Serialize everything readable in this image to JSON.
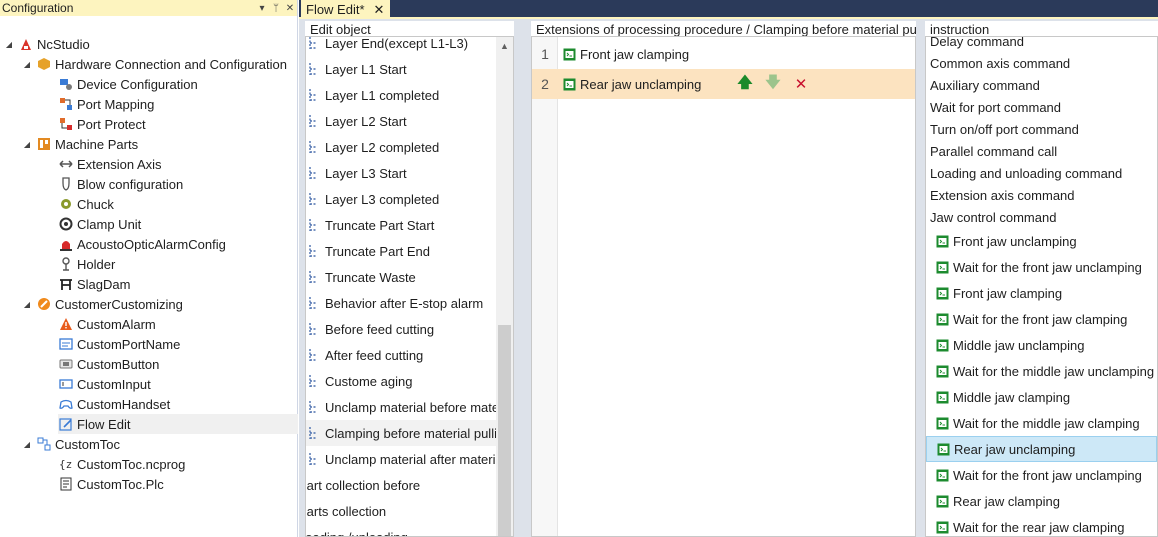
{
  "config_panel": {
    "title": "Configuration",
    "pin_glyph": "▾",
    "pin2_glyph": "ᛘ",
    "close_glyph": "✕",
    "tree": [
      {
        "label": "NcStudio",
        "level": 0,
        "expander": "◢",
        "icon": "app-icon",
        "color": "#d9342b"
      },
      {
        "label": "Hardware Connection and Configuration",
        "level": 1,
        "expander": "◢",
        "icon": "hex-icon",
        "color": "#e6a22a"
      },
      {
        "label": "Device Configuration",
        "level": 2,
        "icon": "device-config-icon",
        "color": "#3a7bd5"
      },
      {
        "label": "Port Mapping",
        "level": 2,
        "icon": "port-mapping-icon",
        "color": "#e06c2b"
      },
      {
        "label": "Port Protect",
        "level": 2,
        "icon": "port-protect-icon",
        "color": "#e06c2b"
      },
      {
        "label": "Machine Parts",
        "level": 1,
        "expander": "◢",
        "icon": "machine-parts-icon",
        "color": "#e38a22"
      },
      {
        "label": "Extension Axis",
        "level": 2,
        "icon": "extension-axis-icon",
        "color": "#555555"
      },
      {
        "label": "Blow configuration",
        "level": 2,
        "icon": "blow-icon",
        "color": "#555555"
      },
      {
        "label": "Chuck",
        "level": 2,
        "icon": "chuck-icon",
        "color": "#8a9a2c"
      },
      {
        "label": "Clamp Unit",
        "level": 2,
        "icon": "clamp-icon",
        "color": "#333333"
      },
      {
        "label": "AcoustoOpticAlarmConfig",
        "level": 2,
        "icon": "alarm-light-icon",
        "color": "#d62b2b"
      },
      {
        "label": "Holder",
        "level": 2,
        "icon": "holder-icon",
        "color": "#555555"
      },
      {
        "label": "SlagDam",
        "level": 2,
        "icon": "slagdam-icon",
        "color": "#222222"
      },
      {
        "label": "CustomerCustomizing",
        "level": 1,
        "expander": "◢",
        "icon": "customizing-icon",
        "color": "#f08a1c"
      },
      {
        "label": "CustomAlarm",
        "level": 2,
        "icon": "warning-icon",
        "color": "#e85b1c"
      },
      {
        "label": "CustomPortName",
        "level": 2,
        "icon": "port-name-icon",
        "color": "#3a7bd5"
      },
      {
        "label": "CustomButton",
        "level": 2,
        "icon": "button-icon",
        "color": "#777777"
      },
      {
        "label": "CustomInput",
        "level": 2,
        "icon": "input-icon",
        "color": "#3a7bd5"
      },
      {
        "label": "CustomHandset",
        "level": 2,
        "icon": "gamepad-icon",
        "color": "#3a7bd5"
      },
      {
        "label": "Flow Edit",
        "level": 2,
        "icon": "edit-icon",
        "color": "#3a7bd5",
        "selected": true
      },
      {
        "label": "CustomToc",
        "level": 1,
        "expander": "◢",
        "icon": "toc-icon",
        "color": "#3a7bd5"
      },
      {
        "label": "CustomToc.ncprog",
        "level": 2,
        "icon": "braces-icon",
        "color": "#333333"
      },
      {
        "label": "CustomToc.Plc",
        "level": 2,
        "icon": "plc-icon",
        "color": "#333333"
      }
    ]
  },
  "tabs": [
    {
      "label": "Flow Edit*",
      "close": "✕"
    }
  ],
  "edit_object": {
    "header": "Edit object",
    "scroll_up": "▲",
    "items": [
      {
        "label": "Layer End(except L1-L3)"
      },
      {
        "label": "Layer L1 Start"
      },
      {
        "label": "Layer L1 completed"
      },
      {
        "label": "Layer L2 Start"
      },
      {
        "label": "Layer L2 completed"
      },
      {
        "label": "Layer L3 Start"
      },
      {
        "label": "Layer L3 completed"
      },
      {
        "label": "Truncate Part Start"
      },
      {
        "label": "Truncate Part End"
      },
      {
        "label": "Truncate Waste"
      },
      {
        "label": "Behavior after E-stop alarm"
      },
      {
        "label": "Before feed cutting"
      },
      {
        "label": "After feed cutting"
      },
      {
        "label": "Custome aging"
      },
      {
        "label": "Unclamp material before material pulling"
      },
      {
        "label": "Clamping before material pulling",
        "selected": true
      },
      {
        "label": "Unclamp material after material pulling"
      },
      {
        "label": "Part collection before",
        "shifted": true
      },
      {
        "label": "Parts collection",
        "shifted": true
      },
      {
        "label": "Loading /unloading",
        "shifted": true
      }
    ]
  },
  "extensions": {
    "header": "Extensions of processing procedure / Clamping before material pulling",
    "rows": [
      {
        "num": "1",
        "label": "Front jaw clamping"
      },
      {
        "num": "2",
        "label": "Rear jaw unclamping",
        "highlight": true
      }
    ],
    "actions": {
      "up": "🡅",
      "down": "🡇",
      "delete": "✕"
    },
    "action_colors": {
      "up": "#1b8a2a",
      "down": "#9cc48c",
      "delete": "#c8102e"
    }
  },
  "instruction": {
    "header": "instruction",
    "items": [
      {
        "label": "Delay command",
        "type": "top"
      },
      {
        "label": "Common axis command",
        "type": "top"
      },
      {
        "label": "Auxiliary command",
        "type": "top"
      },
      {
        "label": "Wait for port command",
        "type": "top"
      },
      {
        "label": "Turn on/off port command",
        "type": "top"
      },
      {
        "label": "Parallel command call",
        "type": "top"
      },
      {
        "label": "Loading and unloading command",
        "type": "top"
      },
      {
        "label": "Extension axis command",
        "type": "top"
      },
      {
        "label": "Jaw control command",
        "type": "top"
      },
      {
        "label": "Front jaw unclamping",
        "type": "sub"
      },
      {
        "label": "Wait for the front jaw unclamping",
        "type": "sub"
      },
      {
        "label": "Front jaw clamping",
        "type": "sub"
      },
      {
        "label": "Wait for the front jaw clamping",
        "type": "sub"
      },
      {
        "label": "Middle jaw unclamping",
        "type": "sub"
      },
      {
        "label": "Wait for the middle jaw unclamping",
        "type": "sub"
      },
      {
        "label": "Middle jaw clamping",
        "type": "sub"
      },
      {
        "label": "Wait for the middle jaw clamping",
        "type": "sub"
      },
      {
        "label": "Rear jaw unclamping",
        "type": "sub",
        "selected": true
      },
      {
        "label": "Wait for the front jaw unclamping",
        "type": "sub"
      },
      {
        "label": "Rear jaw clamping",
        "type": "sub"
      },
      {
        "label": "Wait for the rear jaw clamping",
        "type": "sub"
      }
    ]
  },
  "colors": {
    "tab_active": "#fdf4bf",
    "tab_strip": "#2b3a5a",
    "selection_blue": "#cde8f7",
    "row_highlight": "#fce3c0",
    "command_icon_green": "#1d8b2f"
  }
}
